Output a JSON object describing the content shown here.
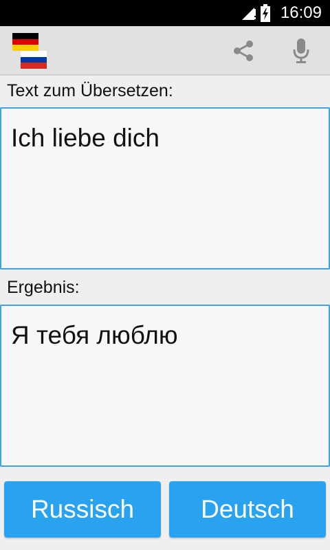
{
  "status_bar": {
    "time": "16:09",
    "icons": [
      "signal-icon",
      "battery-charging-icon"
    ]
  },
  "toolbar": {
    "source_flag": "german-flag-icon",
    "target_flag": "russian-flag-icon",
    "share_icon": "share-icon",
    "mic_icon": "microphone-icon"
  },
  "input": {
    "label": "Text zum Übersetzen:",
    "value": "Ich liebe dich"
  },
  "result": {
    "label": "Ergebnis:",
    "value": "Я тебя люблю"
  },
  "buttons": {
    "left_label": "Russisch",
    "right_label": "Deutsch"
  },
  "colors": {
    "accent": "#29a3ef",
    "border": "#3aa3e0"
  }
}
